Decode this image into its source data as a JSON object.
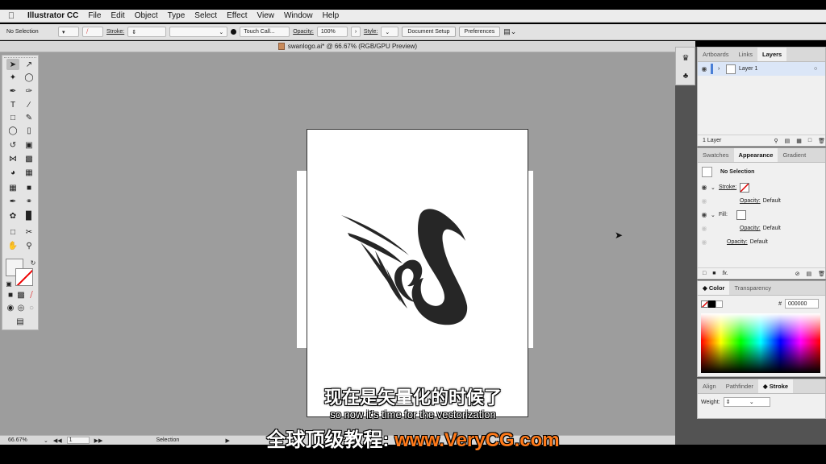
{
  "menubar": {
    "items": [
      "Illustrator CC",
      "File",
      "Edit",
      "Object",
      "Type",
      "Select",
      "Effect",
      "View",
      "Window",
      "Help"
    ]
  },
  "controlbar": {
    "selection": "No Selection",
    "stroke_label": "Stroke:",
    "brush": "Touch Call...",
    "opacity_label": "Opacity:",
    "opacity_value": "100%",
    "style_label": "Style:",
    "document_setup": "Document Setup",
    "preferences": "Preferences"
  },
  "document": {
    "tab_title": "swanlogo.ai* @ 66.67% (RGB/GPU Preview)"
  },
  "statusbar": {
    "zoom": "66.67%",
    "artboard": "1",
    "tool": "Selection"
  },
  "layers_panel": {
    "tabs": [
      "Artboards",
      "Links",
      "Layers"
    ],
    "active_tab": "Layers",
    "layer_name": "Layer 1",
    "footer": "1 Layer"
  },
  "appearance_panel": {
    "tabs": [
      "Swatches",
      "Appearance",
      "Gradient"
    ],
    "active_tab": "Appearance",
    "title": "No Selection",
    "stroke_label": "Stroke:",
    "opacity_label": "Opacity:",
    "opacity_value": "Default",
    "fill_label": "Fill:",
    "fx_label": "fx."
  },
  "color_panel": {
    "tabs": [
      "Color",
      "Transparency"
    ],
    "active_tab": "Color",
    "hex": "000000",
    "hash": "#"
  },
  "stroke_panel": {
    "tabs": [
      "Align",
      "Pathfinder",
      "Stroke"
    ],
    "active_tab": "Stroke",
    "weight_label": "Weight:"
  },
  "subtitles": {
    "chinese": "现在是矢量化的时候了",
    "english": "so now it's time for the vectorization",
    "watermark_prefix": "全球顶级教程:",
    "watermark_url": "www.VeryCG.com"
  },
  "colors": {
    "layer_accent": "#4a7fd6",
    "watermark_url": "#ff7a1a",
    "swan": "#262626"
  }
}
